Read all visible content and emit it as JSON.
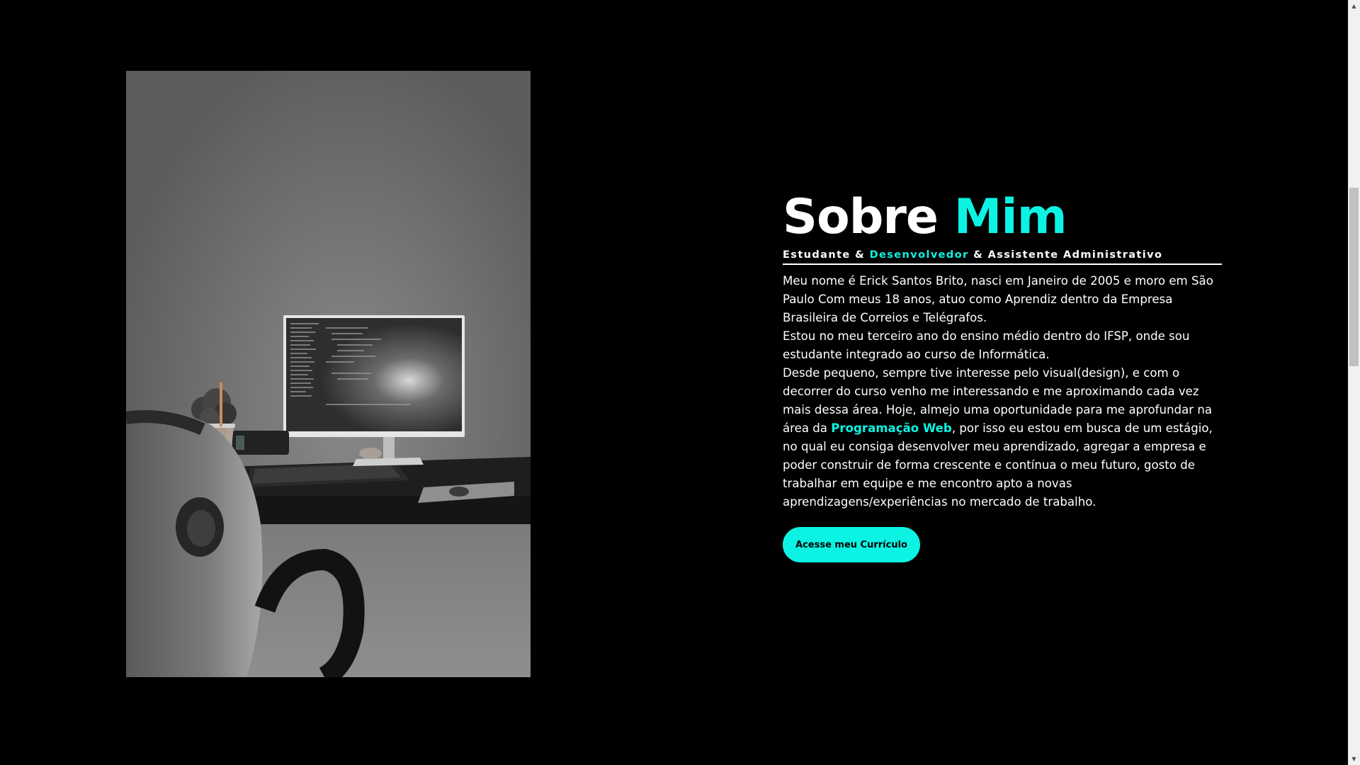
{
  "about": {
    "title_main": "Sobre",
    "title_accent": "Mim",
    "subtitle": {
      "part1": "Estudante &",
      "accent": "Desenvolvedor",
      "part2": "& Assistente Administrativo"
    },
    "bio": {
      "p1": "Meu nome é Erick Santos Brito, nasci em Janeiro de 2005 e moro em São Paulo Com meus 18 anos, atuo como Aprendiz dentro da Empresa Brasileira de Correios e Telégrafos.",
      "p2": "Estou no meu terceiro ano do ensino médio dentro do IFSP, onde sou estudante integrado ao curso de Informática.",
      "p3_before": "Desde pequeno, sempre tive interesse pelo visual(design), e com o decorrer do curso venho me interessando e me aproximando cada vez mais dessa área. Hoje, almejo uma oportunidade para me aprofundar na área da",
      "p3_accent": "Programação Web",
      "p3_after": ", por isso eu estou em busca de um estágio, no qual eu consiga desenvolver meu aprendizado, agregar a empresa e poder construir de forma crescente e contínua o meu futuro, gosto de trabalhar em equipe e me encontro apto a novas aprendizagens/experiências no mercado de trabalho."
    },
    "cta_label": "Acesse meu Currículo"
  },
  "scrollbar": {
    "up_icon": "triangle-up",
    "down_icon": "triangle-down"
  },
  "colors": {
    "background": "#000000",
    "accent": "#0df3e3",
    "text": "#ffffff"
  }
}
